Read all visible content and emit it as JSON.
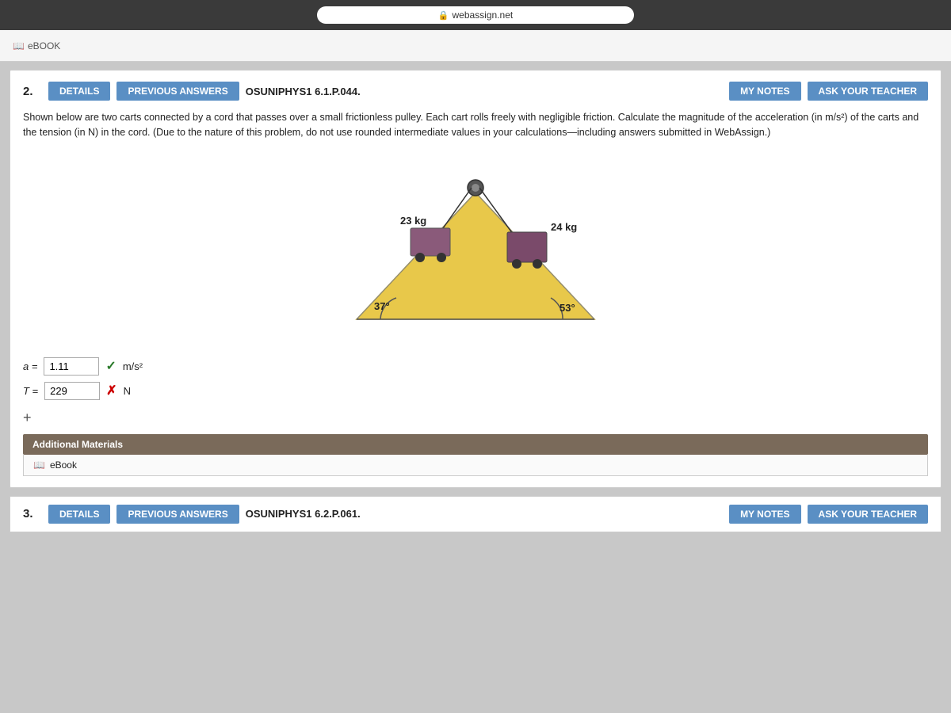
{
  "browser": {
    "url": "webassign.net",
    "lock_icon": "🔒"
  },
  "ebook_bar": {
    "label": "eBOOK"
  },
  "question2": {
    "number": "2.",
    "details_btn": "DETAILS",
    "prev_answers_btn": "PREVIOUS ANSWERS",
    "problem_id": "OSUNIPHYS1 6.1.P.044.",
    "my_notes_btn": "MY NOTES",
    "ask_teacher_btn": "ASK YOUR TEACHER",
    "problem_text": "Shown below are two carts connected by a cord that passes over a small frictionless pulley. Each cart rolls freely with negligible friction. Calculate the magnitude of the acceleration (in m/s²) of the carts and the tension (in N) in the cord. (Due to the nature of this problem, do not use rounded intermediate values in your calculations—including answers submitted in WebAssign.)",
    "diagram": {
      "mass_left": "23 kg",
      "mass_right": "24 kg",
      "angle_left": "37°",
      "angle_right": "53°"
    },
    "answer_a": {
      "label": "a =",
      "value": "1.11",
      "status": "correct",
      "unit": "m/s²"
    },
    "answer_T": {
      "label": "T =",
      "value": "229",
      "status": "incorrect",
      "unit": "N"
    },
    "plus_symbol": "+",
    "additional_materials_label": "Additional Materials",
    "ebook_link": "eBook"
  },
  "question3": {
    "number": "3.",
    "details_btn": "DETAILS",
    "prev_answers_btn": "PREVIOUS ANSWERS",
    "problem_id": "OSUNIPHYS1 6.2.P.061.",
    "my_notes_btn": "MY NOTES",
    "ask_teacher_btn": "ASK YOUR TEACHER"
  }
}
